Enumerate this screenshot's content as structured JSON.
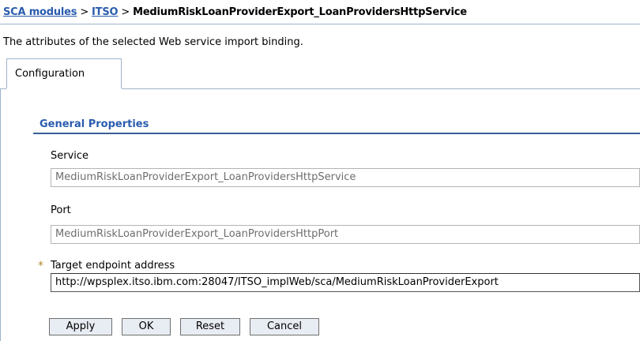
{
  "breadcrumb": {
    "items": [
      "SCA modules",
      "ITSO"
    ],
    "separator": ">",
    "current": "MediumRiskLoanProviderExport_LoanProvidersHttpService"
  },
  "description": "The attributes of the selected Web service import binding.",
  "tabs": [
    {
      "label": "Configuration",
      "active": true
    }
  ],
  "section": {
    "title": "General Properties"
  },
  "fields": {
    "service": {
      "label": "Service",
      "value": "MediumRiskLoanProviderExport_LoanProvidersHttpService",
      "readonly": true
    },
    "port": {
      "label": "Port",
      "value": "MediumRiskLoanProviderExport_LoanProvidersHttpPort",
      "readonly": true
    },
    "target_endpoint": {
      "label": "Target endpoint address",
      "value": "http://wpsplex.itso.ibm.com:28047/ITSO_implWeb/sca/MediumRiskLoanProviderExport",
      "required": true,
      "required_marker": "*"
    }
  },
  "buttons": {
    "apply": "Apply",
    "ok": "OK",
    "reset": "Reset",
    "cancel": "Cancel"
  },
  "colors": {
    "link": "#2a5cae",
    "section_rule": "#3b5f99",
    "required_marker": "#b38a2c"
  }
}
